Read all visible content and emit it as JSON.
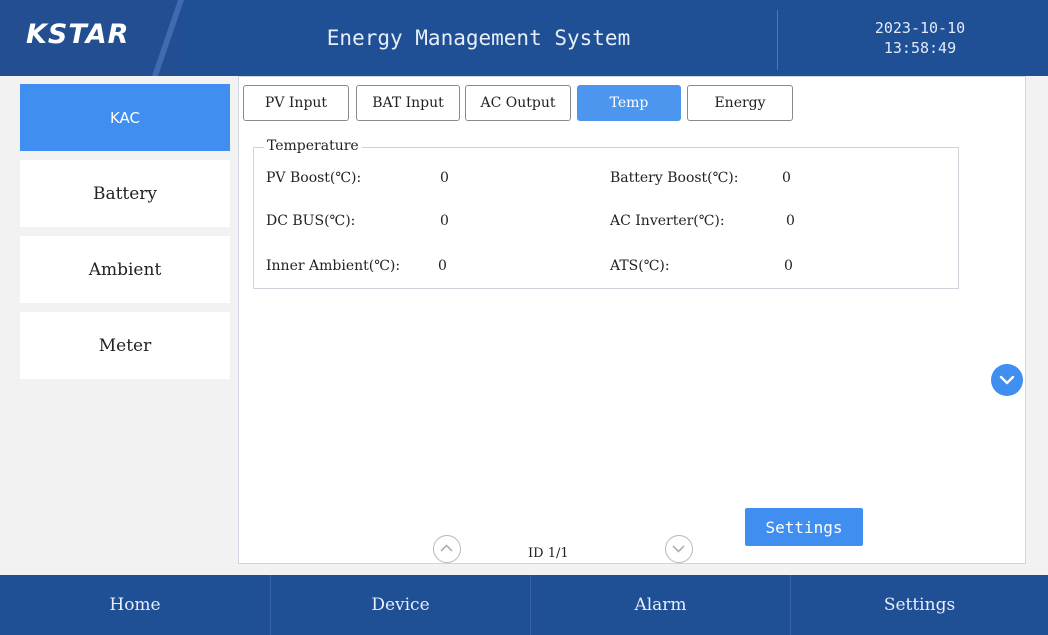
{
  "header": {
    "logo": "KSTAR",
    "title": "Energy Management System",
    "date": "2023-10-10",
    "time": "13:58:49"
  },
  "sidebar": {
    "items": [
      {
        "label": "KAC",
        "active": true
      },
      {
        "label": "Battery",
        "active": false
      },
      {
        "label": "Ambient",
        "active": false
      },
      {
        "label": "Meter",
        "active": false
      }
    ]
  },
  "tabs": [
    {
      "label": "PV Input",
      "active": false
    },
    {
      "label": "BAT Input",
      "active": false
    },
    {
      "label": "AC Output",
      "active": false
    },
    {
      "label": "Temp",
      "active": true
    },
    {
      "label": "Energy",
      "active": false
    }
  ],
  "temperature": {
    "group_title": "Temperature",
    "fields": [
      {
        "label": "PV Boost(℃):",
        "value": "0"
      },
      {
        "label": "Battery Boost(℃):",
        "value": "0"
      },
      {
        "label": "DC BUS(℃):",
        "value": "0"
      },
      {
        "label": "AC Inverter(℃):",
        "value": "0"
      },
      {
        "label": "Inner Ambient(℃):",
        "value": "0"
      },
      {
        "label": "ATS(℃):",
        "value": "0"
      }
    ]
  },
  "pager": {
    "text": "ID 1/1"
  },
  "settings_button": {
    "label": "Settings"
  },
  "footer": {
    "items": [
      "Home",
      "Device",
      "Alarm",
      "Settings"
    ]
  },
  "colors": {
    "header_bg": "#1f4f95",
    "accent": "#3f8ef0",
    "panel_bg": "#ffffff"
  },
  "icons": {
    "scroll_down": "chevron-down-icon",
    "page_up": "chevron-up-icon",
    "page_down": "chevron-down-icon"
  }
}
